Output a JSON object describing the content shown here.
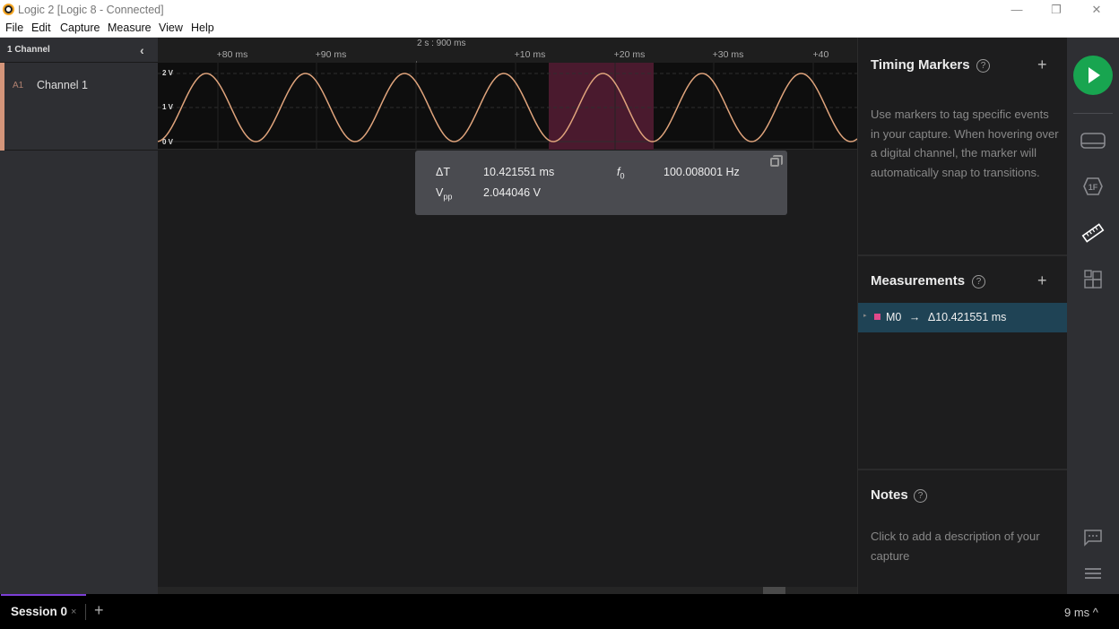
{
  "window": {
    "title": "Logic 2 [Logic 8 - Connected]",
    "controls": {
      "minimize": "—",
      "restore": "❐",
      "close": "✕"
    }
  },
  "menu": [
    "File",
    "Edit",
    "Capture",
    "Measure",
    "View",
    "Help"
  ],
  "left_panel": {
    "header": "1 Channel",
    "collapse_icon": "‹",
    "channels": [
      {
        "id": "A1",
        "name": "Channel 1",
        "color": "#d4957a"
      }
    ]
  },
  "timeline": {
    "anchor": "2 s : 900 ms",
    "ticks": [
      "+80 ms",
      "+90 ms",
      "+10 ms",
      "+20 ms",
      "+30 ms",
      "+40 ms"
    ]
  },
  "waveform": {
    "y_labels": [
      "2 V",
      "1 V",
      "0 V"
    ],
    "signal": {
      "type": "sine",
      "frequency_hz": 100.008001,
      "min_v": 0,
      "max_v": 2.044046
    },
    "selection_color": "#4a1a2e",
    "trace_color": "#e0a47c"
  },
  "measurement_popup": {
    "rows": [
      {
        "label": "ΔT",
        "value": "10.421551 ms"
      },
      {
        "label": "Vpp",
        "value": "2.044046 V"
      },
      {
        "label": "f0",
        "value": "100.008001 Hz"
      }
    ]
  },
  "right_panel": {
    "timing_markers": {
      "title": "Timing Markers",
      "help": "?",
      "add": "+",
      "description": "Use markers to tag specific events in your capture. When hovering over a digital channel, the marker will automatically snap to transitions."
    },
    "measurements": {
      "title": "Measurements",
      "help": "?",
      "add": "+",
      "items": [
        {
          "caret": "▸",
          "name": "M0",
          "arrow": "→",
          "value": "Δ10.421551 ms",
          "color": "#e0498a"
        }
      ]
    },
    "notes": {
      "title": "Notes",
      "help": "?",
      "placeholder": "Click to add a description of your capture"
    }
  },
  "side_rail": {
    "icons": [
      "play-icon",
      "analyzers-icon",
      "1f-extensions-icon",
      "measure-ruler-icon",
      "layout-icon",
      "chat-icon",
      "menu-icon"
    ],
    "accent": "#18a550"
  },
  "bottom_bar": {
    "session_tab": "Session 0",
    "close": "×",
    "add": "+",
    "zoom_readout": "9 ms ^"
  }
}
